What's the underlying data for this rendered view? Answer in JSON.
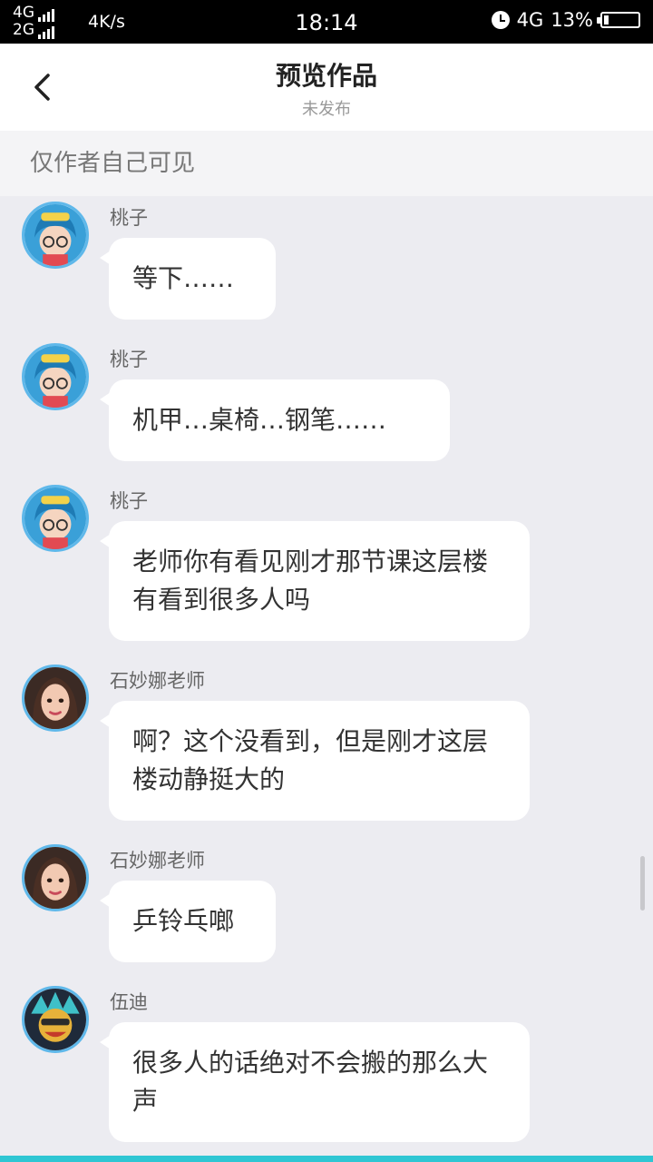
{
  "status_bar": {
    "network_top": "4G",
    "network_bottom": "2G",
    "speed": "4K/s",
    "time": "18:14",
    "network_right": "4G",
    "battery": "13%",
    "battery_level": 0.13
  },
  "header": {
    "title": "预览作品",
    "subtitle": "未发布",
    "back_icon": "chevron-left-icon"
  },
  "visibility_notice": "仅作者自己可见",
  "messages": [
    {
      "name": "桃子",
      "avatar": "peach-avatar",
      "text": "等下……"
    },
    {
      "name": "桃子",
      "avatar": "peach-avatar",
      "text": "机甲…桌椅…钢笔……"
    },
    {
      "name": "桃子",
      "avatar": "peach-avatar",
      "text": "老师你有看见刚才那节课这层楼有看到很多人吗"
    },
    {
      "name": "石妙娜老师",
      "avatar": "teacher-avatar",
      "text": "啊？这个没看到，但是刚才这层楼动静挺大的"
    },
    {
      "name": "石妙娜老师",
      "avatar": "teacher-avatar",
      "text": "乒铃乓啷"
    },
    {
      "name": "伍迪",
      "avatar": "woody-avatar",
      "text": "很多人的话绝对不会搬的那么大声"
    }
  ],
  "colors": {
    "avatar_ring": "#5fb8ea",
    "background": "#ececf1",
    "bottom_accent": "#2fc6d3"
  }
}
